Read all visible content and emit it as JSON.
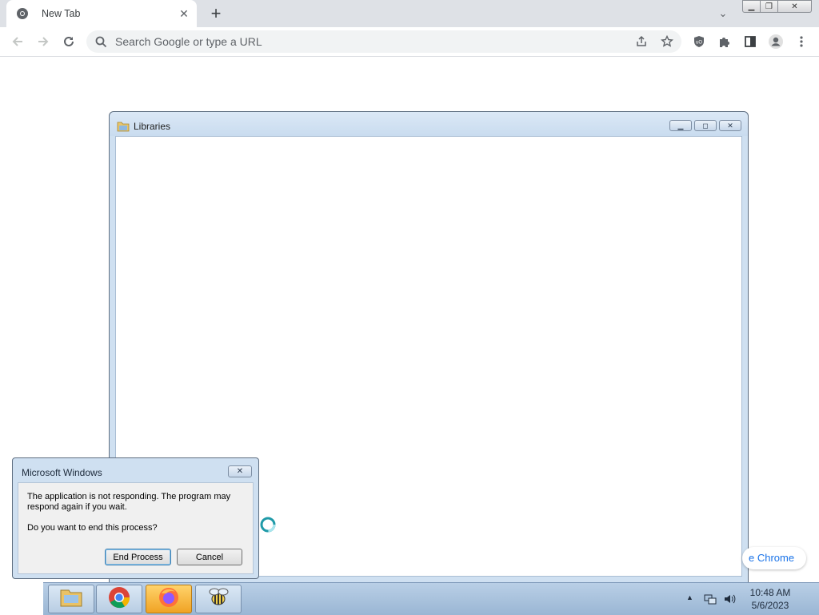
{
  "browser": {
    "tab_title": "New Tab",
    "tab_close_icon": "close-icon",
    "new_tab_icon": "plus-icon",
    "omnibox_placeholder": "Search Google or type a URL"
  },
  "libraries_window": {
    "title": "Libraries"
  },
  "dialog": {
    "title": "Microsoft Windows",
    "message": "The application is not responding. The program may respond again if you wait.",
    "question": "Do you want to end this process?",
    "end_process_label": "End Process",
    "cancel_label": "Cancel"
  },
  "toast": {
    "text": "e Chrome"
  },
  "taskbar": {
    "items": [
      "file-explorer-icon",
      "chrome-icon",
      "firefox-icon",
      "bee-app-icon"
    ],
    "time": "10:48 AM",
    "date": "5/6/2023"
  },
  "colors": {
    "chrome_accent": "#1a73e8",
    "window_frame": "#cfe0f1",
    "taskbar": "#9ab6d4"
  }
}
